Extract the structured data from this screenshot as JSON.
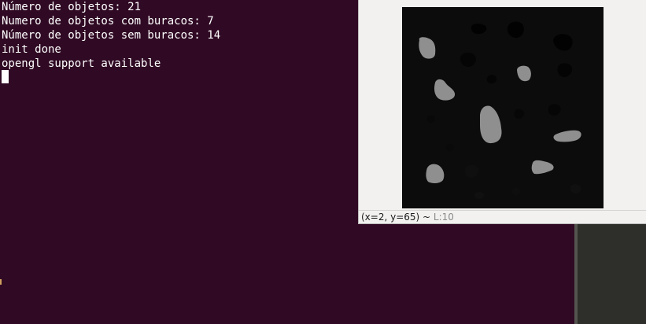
{
  "terminal": {
    "lines": [
      "Número de objetos: 21",
      "Numero de objetos com buracos: 7",
      "Número de objetos sem buracos: 14",
      "init done",
      "opengl support available"
    ]
  },
  "viewer": {
    "status": {
      "coords": "(x=2, y=65)",
      "separator": " ~ ",
      "level": "L:10"
    }
  },
  "colors": {
    "terminal_bg": "#300a24",
    "terminal_text": "#ffffff",
    "image_bg": "#0c0c0c",
    "blob_light": "#8f8f8f",
    "blob_dark": "#020202"
  }
}
